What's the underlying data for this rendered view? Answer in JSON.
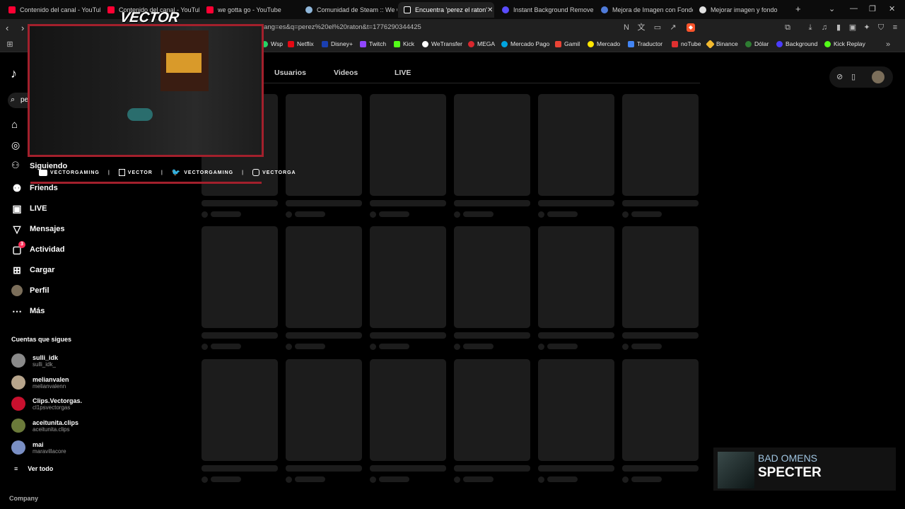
{
  "browser": {
    "tabs": [
      {
        "title": "Contenido del canal - YouTube",
        "color": "#ff0033"
      },
      {
        "title": "Contenido del canal - YouTube",
        "color": "#ff0033"
      },
      {
        "title": "we gotta go - YouTube",
        "color": "#ff0033"
      },
      {
        "title": "Comunidad de Steam :: We G",
        "color": "#8fb6d9"
      },
      {
        "title": "Encuentra 'perez el raton'",
        "color": "#ffffff"
      },
      {
        "title": "Instant Background Remover",
        "color": "#5a4cff"
      },
      {
        "title": "Mejora de Imagen con Fondo",
        "color": "#4f7bd9"
      },
      {
        "title": "Mejorar imagen y fondo",
        "color": "#e0e0e0"
      }
    ],
    "url": "lang=es&q=perez%20el%20raton&t=1776290344425",
    "bookmarks": [
      {
        "label": "Wsp",
        "color": "#25d366"
      },
      {
        "label": "Netflix",
        "color": "#e50914"
      },
      {
        "label": "Disney+",
        "color": "#1a3fb0"
      },
      {
        "label": "Twitch",
        "color": "#9146ff"
      },
      {
        "label": "Kick",
        "color": "#53fc18"
      },
      {
        "label": "WeTransfer",
        "color": "#ffffff"
      },
      {
        "label": "MEGA",
        "color": "#d9272e"
      },
      {
        "label": "Mercado Pago",
        "color": "#00a5e0"
      },
      {
        "label": "Gamil",
        "color": "#ea4335"
      },
      {
        "label": "Mercado",
        "color": "#ffe600"
      },
      {
        "label": "Traductor",
        "color": "#4285f4"
      },
      {
        "label": "noTube",
        "color": "#e03030"
      },
      {
        "label": "Binance",
        "color": "#f3ba2f"
      },
      {
        "label": "Dólar",
        "color": "#2e7d32"
      },
      {
        "label": "Background",
        "color": "#4a3cff"
      },
      {
        "label": "Kick Replay",
        "color": "#53fc18"
      }
    ]
  },
  "search": {
    "query": "pe"
  },
  "top_tabs": [
    "Usuarios",
    "Videos",
    "LIVE"
  ],
  "sidebar": {
    "partial_label": "Siguiendo",
    "items": [
      {
        "label": "Friends",
        "icon": "friends-icon"
      },
      {
        "label": "LIVE",
        "icon": "live-icon"
      },
      {
        "label": "Mensajes",
        "icon": "send-icon"
      },
      {
        "label": "Actividad",
        "icon": "activity-icon",
        "badge": "3"
      },
      {
        "label": "Cargar",
        "icon": "upload-icon"
      },
      {
        "label": "Perfil",
        "icon": "profile-avatar"
      },
      {
        "label": "Más",
        "icon": "more-icon"
      }
    ],
    "following_title": "Cuentas que sigues",
    "following": [
      {
        "name": "sulli_idk",
        "handle": "sulli_idk_",
        "color": "#8a8a8a"
      },
      {
        "name": "melianvalen",
        "handle": "melianvalenn",
        "color": "#b7a58c"
      },
      {
        "name": "Clips.Vectorgas.",
        "handle": "cl1psvectorgas",
        "color": "#c8102e"
      },
      {
        "name": "aceitunita.clips",
        "handle": "aceitunita.clips",
        "color": "#6b7a3a"
      },
      {
        "name": "mai",
        "handle": "maravillacore",
        "color": "#7a8fc4"
      }
    ],
    "see_all": "Ver todo",
    "company": "Company"
  },
  "overlay": {
    "brand": "VECTOR",
    "socials": [
      {
        "icon": "youtube-icon",
        "label": "VECTORGAMING"
      },
      {
        "icon": "twitch-icon",
        "label": "VECTOR"
      },
      {
        "icon": "twitter-icon",
        "label": "VECTORGAMING"
      },
      {
        "icon": "instagram-icon",
        "label": "VECTORGA"
      }
    ]
  },
  "now_playing": {
    "artist": "BAD OMENS",
    "title": "SPECTER"
  }
}
